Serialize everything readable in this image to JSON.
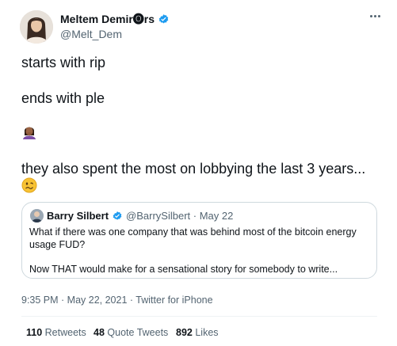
{
  "author": {
    "name": "Meltem Demir🅞rs",
    "handle": "@Melt_Dem",
    "verified": true
  },
  "tweet": {
    "lines": [
      "starts with rip",
      "ends with ple",
      "they also spent the most on lobbying the last 3 years..."
    ],
    "emojis": [
      "woman-facepalming-icon",
      "woozy-face-icon"
    ]
  },
  "quote": {
    "name": "Barry Silbert",
    "handle_date": "@BarrySilbert · May 22",
    "verified": true,
    "lines": [
      "What if there was one company that was behind most of the bitcoin energy",
      "usage FUD?",
      "Now THAT would make for a sensational story for somebody to write..."
    ]
  },
  "meta": {
    "time_date": "9:35 PM · May 22, 2021",
    "separator": " · ",
    "source": "Twitter for iPhone"
  },
  "stats": {
    "retweets_count": "110",
    "retweets_label": "Retweets",
    "quotes_count": "48",
    "quotes_label": "Quote Tweets",
    "likes_count": "892",
    "likes_label": "Likes"
  },
  "colors": {
    "verified": "#1d9bf0",
    "secondary_text": "#536471",
    "border": "#cfd9de"
  }
}
